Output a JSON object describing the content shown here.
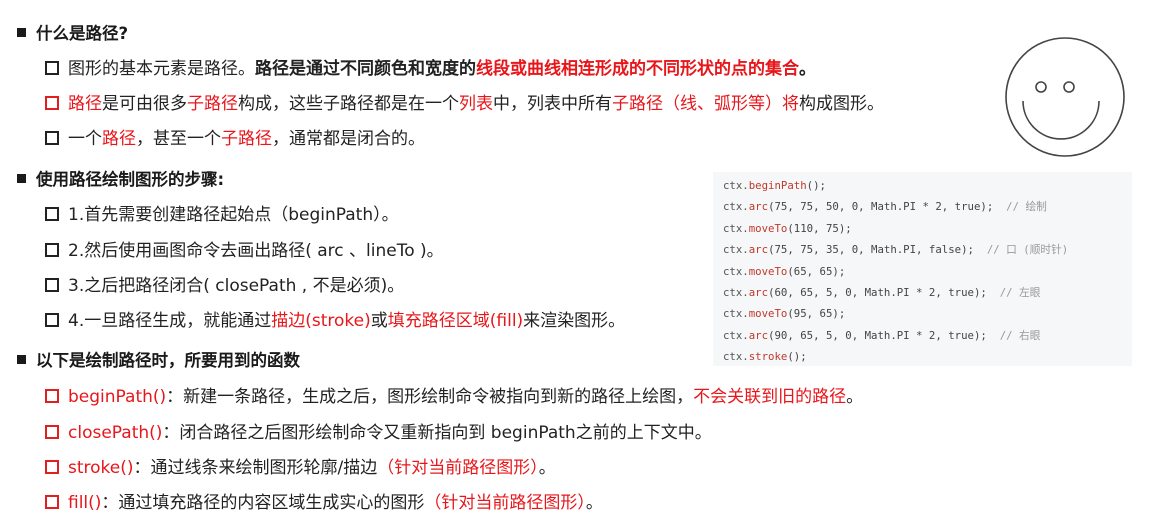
{
  "section1": {
    "heading": "什么是路径?",
    "lines": [
      {
        "parts": [
          {
            "t": "图形的基本元素是路径。",
            "s": ""
          },
          {
            "t": "路径是通过不同颜色和宽度的",
            "s": "b"
          },
          {
            "t": "线段或曲线相连形成的不同形状的点的集合",
            "s": "red b"
          },
          {
            "t": "。",
            "s": "b"
          }
        ],
        "box": "black"
      },
      {
        "parts": [
          {
            "t": "路径",
            "s": "red"
          },
          {
            "t": "是可由很多",
            "s": ""
          },
          {
            "t": "子路径",
            "s": "red"
          },
          {
            "t": "构成，这些子路径都是在一个",
            "s": ""
          },
          {
            "t": "列表",
            "s": "red"
          },
          {
            "t": "中，列表中所有",
            "s": ""
          },
          {
            "t": "子路径（线、弧形等）将",
            "s": "red"
          },
          {
            "t": "构成图形。",
            "s": ""
          }
        ],
        "box": "red"
      },
      {
        "parts": [
          {
            "t": "一个",
            "s": ""
          },
          {
            "t": "路径",
            "s": "red"
          },
          {
            "t": "，甚至一个",
            "s": ""
          },
          {
            "t": "子路径",
            "s": "red"
          },
          {
            "t": "，通常都是闭合的。",
            "s": ""
          }
        ],
        "box": "black"
      }
    ]
  },
  "section2": {
    "heading": "使用路径绘制图形的步骤:",
    "lines": [
      {
        "parts": [
          {
            "t": "1.首先需要创建路径起始点（beginPath）。",
            "s": ""
          }
        ],
        "box": "black"
      },
      {
        "parts": [
          {
            "t": "2.然后使用画图命令去画出路径( arc 、lineTo )。",
            "s": ""
          }
        ],
        "box": "black"
      },
      {
        "parts": [
          {
            "t": "3.之后把路径闭合( closePath , 不是必须)。",
            "s": ""
          }
        ],
        "box": "black"
      },
      {
        "parts": [
          {
            "t": "4.一旦路径生成，就能通过",
            "s": ""
          },
          {
            "t": "描边(stroke)",
            "s": "red"
          },
          {
            "t": "或",
            "s": ""
          },
          {
            "t": "填充路径区域(fill)",
            "s": "red"
          },
          {
            "t": "来渲染图形。",
            "s": ""
          }
        ],
        "box": "black"
      }
    ]
  },
  "section3": {
    "heading": "以下是绘制路径时，所要用到的函数",
    "lines": [
      {
        "parts": [
          {
            "t": "beginPath()",
            "s": "red"
          },
          {
            "t": "：新建一条路径，生成之后，图形绘制命令被指向到新的路径上绘图，",
            "s": ""
          },
          {
            "t": "不会关联到旧的路径",
            "s": "red"
          },
          {
            "t": "。",
            "s": ""
          }
        ],
        "box": "red"
      },
      {
        "parts": [
          {
            "t": "closePath()",
            "s": "red"
          },
          {
            "t": "：闭合路径之后图形绘制命令又重新指向到 beginPath之前的上下文中。",
            "s": ""
          }
        ],
        "box": "red"
      },
      {
        "parts": [
          {
            "t": "stroke()",
            "s": "red"
          },
          {
            "t": "：通过线条来绘制图形轮廓/描边",
            "s": ""
          },
          {
            "t": "（针对当前路径图形）",
            "s": "red"
          },
          {
            "t": "。",
            "s": ""
          }
        ],
        "box": "red"
      },
      {
        "parts": [
          {
            "t": "fill()",
            "s": "red"
          },
          {
            "t": "：通过填充路径的内容区域生成实心的图形",
            "s": ""
          },
          {
            "t": "（针对当前路径图形）",
            "s": "red"
          },
          {
            "t": "。",
            "s": ""
          }
        ],
        "box": "red"
      }
    ]
  },
  "code": [
    {
      "fn": "beginPath",
      "args": "",
      "comment": ""
    },
    {
      "fn": "arc",
      "args": "75, 75, 50, 0, Math.PI * 2, true",
      "comment": "// 绘制"
    },
    {
      "fn": "moveTo",
      "args": "110, 75",
      "comment": ""
    },
    {
      "fn": "arc",
      "args": "75, 75, 35, 0, Math.PI, false",
      "comment": "// 口 (顺时针)"
    },
    {
      "fn": "moveTo",
      "args": "65, 65",
      "comment": ""
    },
    {
      "fn": "arc",
      "args": "60, 65, 5, 0, Math.PI * 2, true",
      "comment": "// 左眼"
    },
    {
      "fn": "moveTo",
      "args": "95, 65",
      "comment": ""
    },
    {
      "fn": "arc",
      "args": "90, 65, 5, 0, Math.PI * 2, true",
      "comment": "// 右眼"
    },
    {
      "fn": "stroke",
      "args": "",
      "comment": ""
    }
  ],
  "code_object": "ctx",
  "colors": {
    "accent_red": "#e8161a",
    "text": "#222222",
    "code_bg": "#f6f7f8"
  },
  "icons": {
    "illustration": "smiley-face-icon",
    "bullet": "checkbox-square-icon"
  }
}
